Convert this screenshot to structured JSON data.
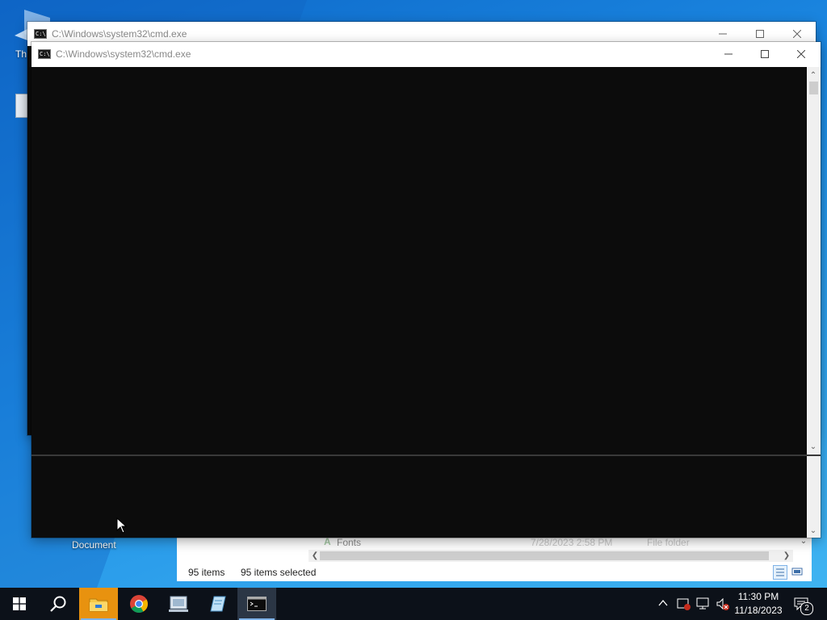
{
  "desktop": {
    "icon_label_partial": "Th",
    "icon_label_document": "Document"
  },
  "window_back": {
    "title": "C:\\Windows\\system32\\cmd.exe",
    "icon_glyph": "C:\\."
  },
  "window_front": {
    "title": "C:\\Windows\\system32\\cmd.exe",
    "icon_glyph": "C:\\."
  },
  "explorer": {
    "row": {
      "name": "Fonts",
      "date": "7/28/2023 2:58 PM",
      "type": "File folder"
    },
    "status": {
      "items": "95 items",
      "selected": "95 items selected"
    }
  },
  "taskbar": {
    "icons": [
      "windows-start-icon",
      "search-icon",
      "file-explorer-icon",
      "chrome-icon",
      "network-doc-icon",
      "notepad-icon",
      "cmd-icon"
    ],
    "clock": {
      "time": "11:30 PM",
      "date": "11/18/2023"
    },
    "notifications_count": "2"
  },
  "colors": {
    "console_bg": "#0c0c0c",
    "taskbar_bg": "#0c1119",
    "desktop_accent": "#1e8ee6"
  }
}
